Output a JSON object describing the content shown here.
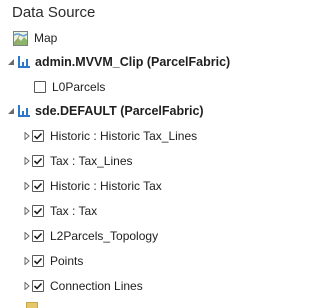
{
  "panel": {
    "title": "Data Source"
  },
  "tree": {
    "map": {
      "label": "Map"
    },
    "fabrics": [
      {
        "label": "admin.MVVM_Clip (ParcelFabric)",
        "expanded": true,
        "children": [
          {
            "label": "L0Parcels",
            "checked": false
          }
        ]
      },
      {
        "label": "sde.DEFAULT (ParcelFabric)",
        "expanded": true,
        "children": [
          {
            "label": "Historic : Historic Tax_Lines",
            "checked": true
          },
          {
            "label": "Tax : Tax_Lines",
            "checked": true
          },
          {
            "label": "Historic : Historic Tax",
            "checked": true
          },
          {
            "label": "Tax : Tax",
            "checked": true
          },
          {
            "label": "L2Parcels_Topology",
            "checked": true
          },
          {
            "label": "Points",
            "checked": true
          },
          {
            "label": "Connection Lines",
            "checked": true
          }
        ]
      }
    ]
  },
  "icons": {
    "map": "map-icon",
    "fabric": "parcel-fabric-icon",
    "expanded": "chevron-expanded-icon",
    "collapsed": "chevron-collapsed-icon",
    "checked": "checkmark-icon"
  },
  "colors": {
    "fabric_blue": "#2e78c8",
    "chevron": "#6a6a6a",
    "checkbox_border": "#5a5a5a"
  }
}
